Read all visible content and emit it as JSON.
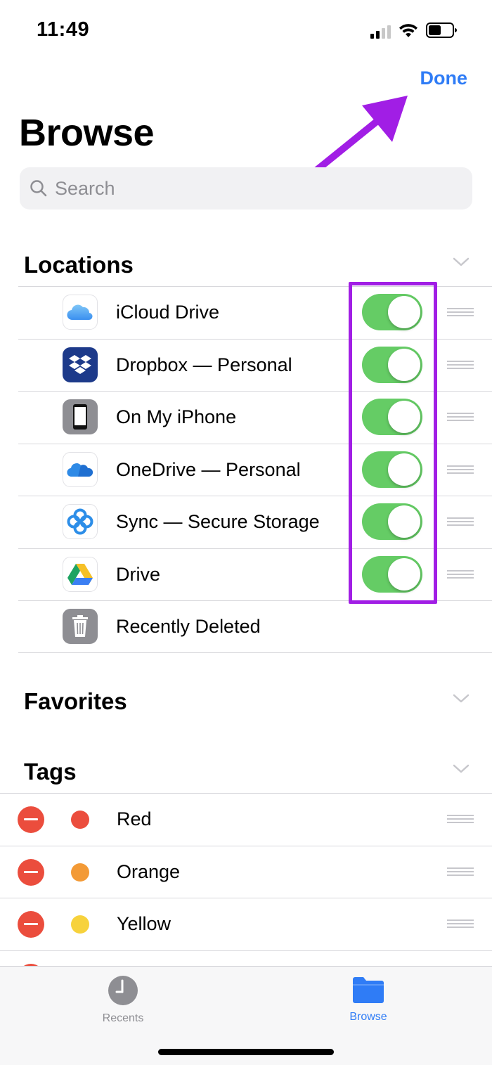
{
  "status": {
    "time": "11:49"
  },
  "header": {
    "done_label": "Done",
    "title": "Browse"
  },
  "search": {
    "placeholder": "Search"
  },
  "sections": {
    "locations": "Locations",
    "favorites": "Favorites",
    "tags": "Tags"
  },
  "locations": [
    {
      "label": "iCloud Drive",
      "icon": "icloud-icon",
      "enabled": true
    },
    {
      "label": "Dropbox — Personal",
      "icon": "dropbox-icon",
      "enabled": true
    },
    {
      "label": "On My iPhone",
      "icon": "iphone-icon",
      "enabled": true
    },
    {
      "label": "OneDrive — Personal",
      "icon": "onedrive-icon",
      "enabled": true
    },
    {
      "label": "Sync — Secure Storage",
      "icon": "sync-icon",
      "enabled": true
    },
    {
      "label": "Drive",
      "icon": "google-drive-icon",
      "enabled": true
    },
    {
      "label": "Recently Deleted",
      "icon": "trash-icon"
    }
  ],
  "tags": [
    {
      "label": "Red",
      "color": "#eb4d3d"
    },
    {
      "label": "Orange",
      "color": "#f39a36"
    },
    {
      "label": "Yellow",
      "color": "#f7d23c"
    }
  ],
  "tabbar": {
    "recents": {
      "label": "Recents",
      "icon": "clock-icon",
      "color": "#8e8e93"
    },
    "browse": {
      "label": "Browse",
      "icon": "folder-icon",
      "color": "#2f7cf6",
      "active": true
    }
  },
  "colors": {
    "accent": "#2f7cf6",
    "toggle_on": "#65cc65",
    "annotation": "#a11ee5",
    "destructive": "#eb4d3d"
  }
}
